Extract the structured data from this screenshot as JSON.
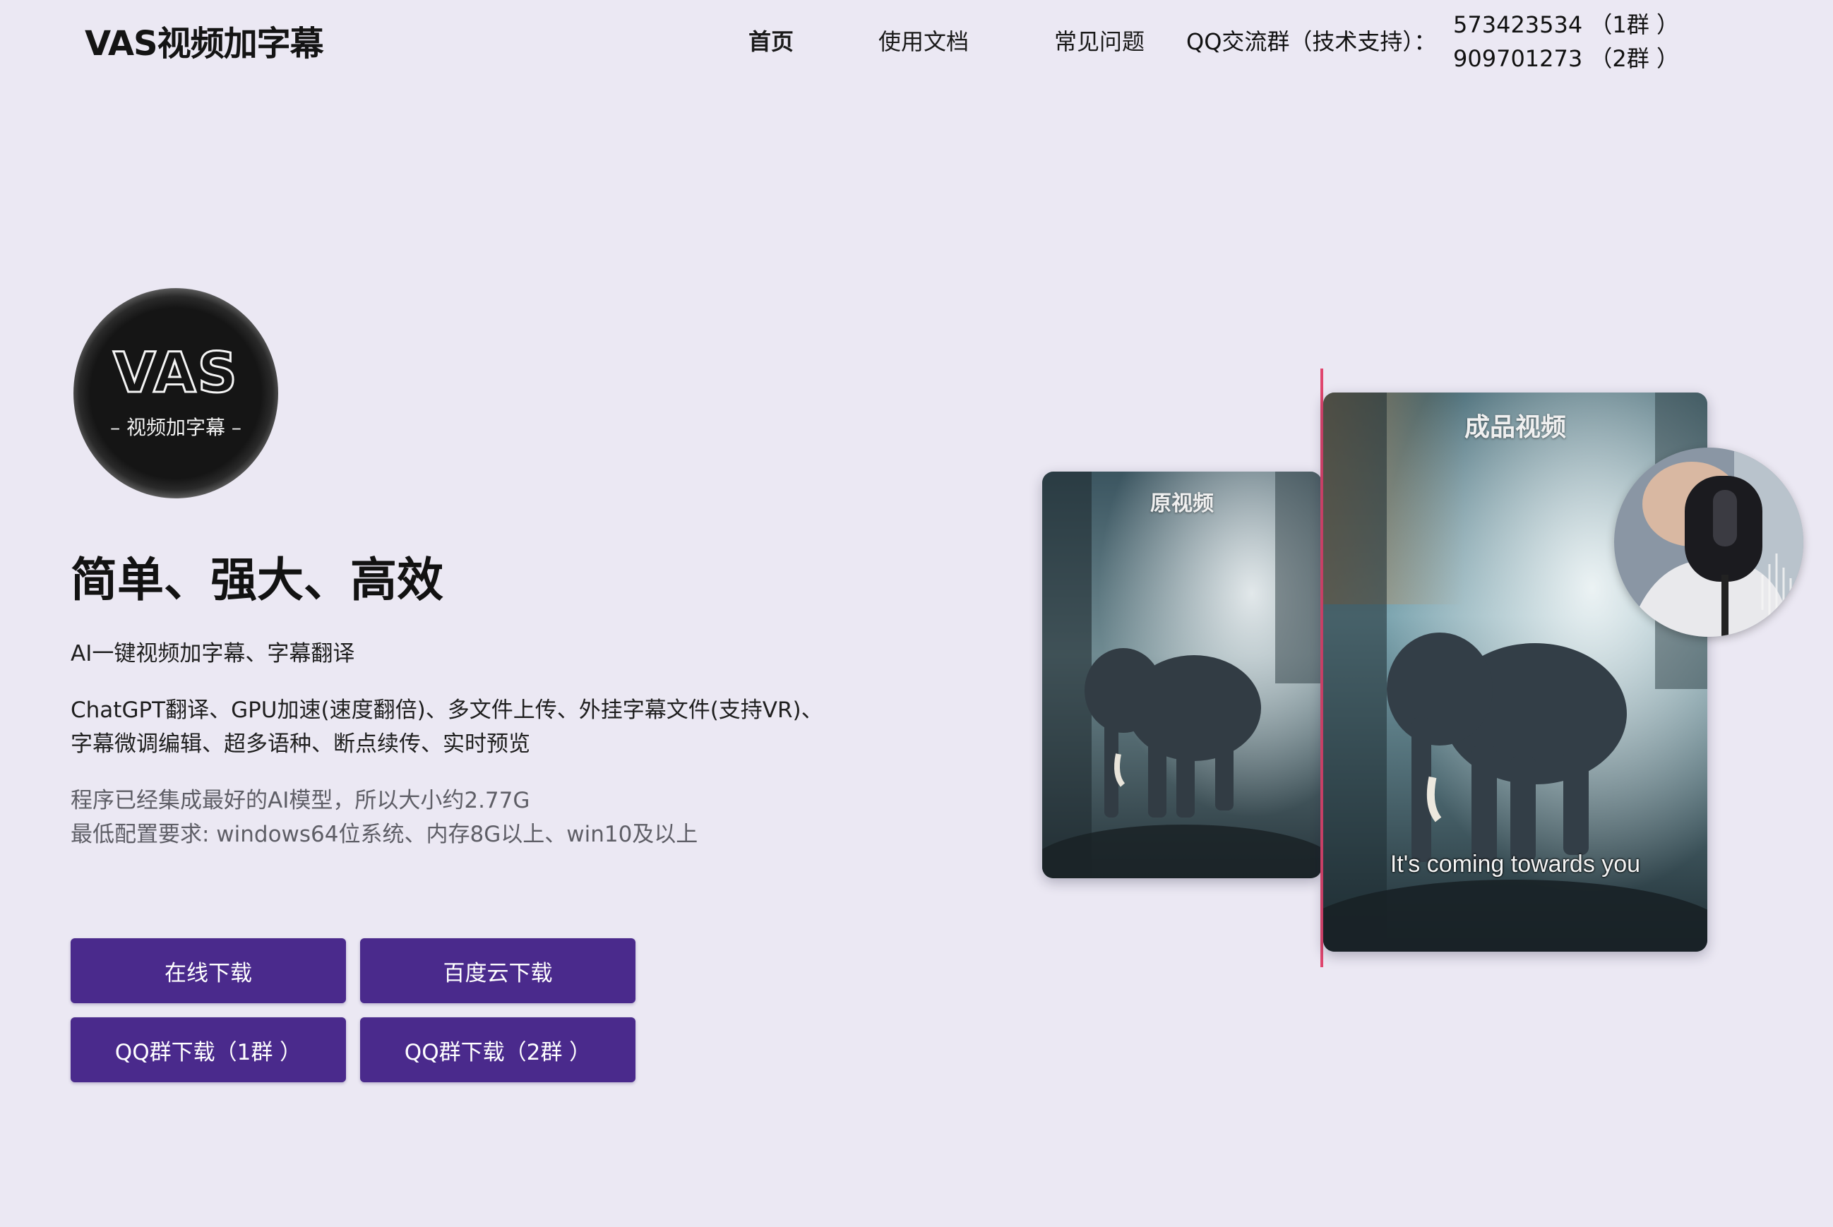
{
  "header": {
    "site_title": "VAS视频加字幕",
    "nav": [
      {
        "label": "首页"
      },
      {
        "label": "使用文档"
      },
      {
        "label": "常见问题"
      }
    ],
    "qq_label": "QQ交流群（技术支持）：",
    "qq_groups": [
      "573423534 （1群 ）",
      "909701273 （2群 ）"
    ]
  },
  "logo": {
    "text": "VAS",
    "subtitle": "– 视频加字幕 –"
  },
  "hero": {
    "title": "简单、强大、高效",
    "tagline": "AI一键视频加字幕、字幕翻译",
    "features_line1": "ChatGPT翻译、GPU加速(速度翻倍)、多文件上传、外挂字幕文件(支持VR)、",
    "features_line2": "字幕微调编辑、超多语种、断点续传、实时预览",
    "note_line1": "程序已经集成最好的AI模型，所以大小约2.77G",
    "note_line2": "最低配置要求: windows64位系统、内存8G以上、win10及以上"
  },
  "buttons": {
    "online": "在线下载",
    "baidu": "百度云下载",
    "qq1": "QQ群下载（1群 ）",
    "qq2": "QQ群下载（2群 ）"
  },
  "preview": {
    "original_label": "原视频",
    "result_label": "成品视频",
    "subtitle": "It's coming towards you"
  },
  "colors": {
    "background": "#ebe8f3",
    "button": "#4a2a8c",
    "divider": "#e0466e"
  }
}
